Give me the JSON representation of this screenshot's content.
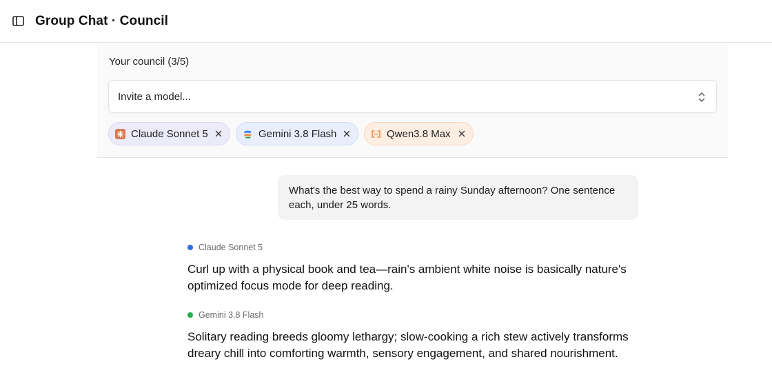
{
  "header": {
    "title": "Group Chat · Council",
    "sidebar_toggle_icon": "sidebar-toggle-icon"
  },
  "council": {
    "title": "Your council (3/5)",
    "invite_placeholder": "Invite a model...",
    "chips": [
      {
        "label": "Claude Sonnet 5",
        "icon": "claude-logo-icon",
        "bg": "#ecebf9",
        "icon_color": "#d9774f"
      },
      {
        "label": "Gemini 3.8 Flash",
        "icon": "gemini-logo-icon",
        "bg": "#e8eefb",
        "icon_color": "#4285f4"
      },
      {
        "label": "Qwen3.8 Max",
        "icon": "qwen-logo-icon",
        "bg": "#fdeee3",
        "icon_color": "#f08a3c"
      }
    ]
  },
  "conversation": {
    "user_message": "What's the best way to spend a rainy Sunday afternoon? One sentence each, under 25 words.",
    "responses": [
      {
        "model": "Claude Sonnet 5",
        "dot_color": "#2f6fe0",
        "text": "Curl up with a physical book and tea—rain's ambient white noise is basically nature's optimized focus mode for deep reading."
      },
      {
        "model": "Gemini 3.8 Flash",
        "dot_color": "#22b14c",
        "text": "Solitary reading breeds gloomy lethargy; slow-cooking a rich stew actively transforms dreary chill into comforting warmth, sensory engagement, and shared nourishment."
      }
    ]
  }
}
